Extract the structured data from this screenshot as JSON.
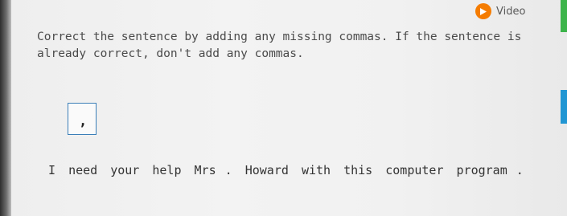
{
  "header": {
    "video_label": "Video"
  },
  "colors": {
    "video_icon": "#f57c00",
    "accent_green": "#3cb44a",
    "accent_blue": "#2196d3",
    "tile_border": "#3b7fb8"
  },
  "icons": {
    "video": "play-circle-icon"
  },
  "question": {
    "instructions": "Correct the sentence by adding any missing commas. If the sentence is already correct, don't add any commas."
  },
  "tile": {
    "comma": ","
  },
  "sentence": {
    "tokens": [
      "I",
      "need",
      "your",
      "help",
      "Mrs",
      ".",
      "Howard",
      "with",
      "this",
      "computer",
      "program",
      "."
    ]
  }
}
